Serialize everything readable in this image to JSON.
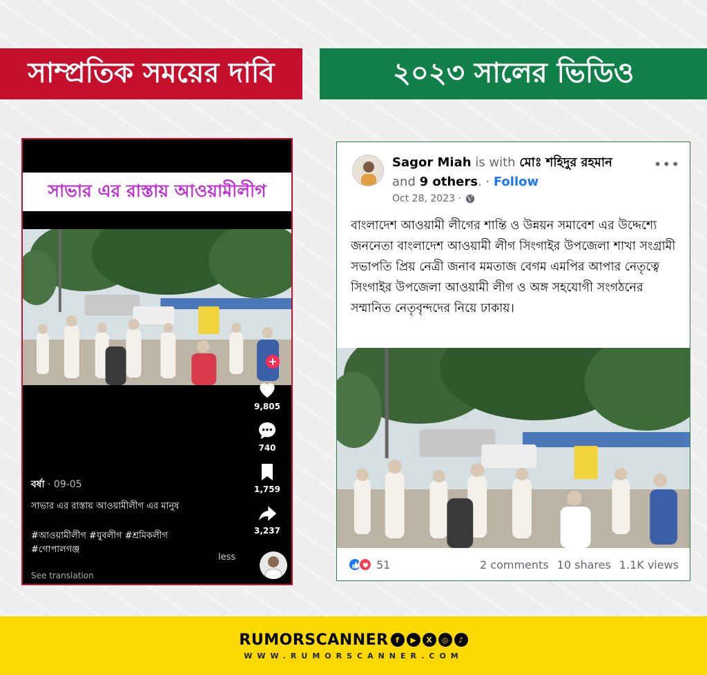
{
  "banners": {
    "left": "সাম্প্রতিক সময়ের দাবি",
    "right": "২০২৩ সালের ভিডিও"
  },
  "tiktok": {
    "caption": "সাভার এর রাস্তায় আওয়ামীলীগ",
    "username": "বর্ষা",
    "date": " · 09-05",
    "description": "সাভার এর রাস্তায় আওয়ামীলীগ এর মানুষ",
    "tags_line1": "#আওয়ামীলীগ #যুবলীগ #শ্রমিকলীগ",
    "tags_line2": "#গোপালগঞ্জ",
    "less_label": "less",
    "translate_label": "See translation",
    "plus_label": "+",
    "likes": "9,805",
    "comments": "740",
    "saves": "1,759",
    "shares": "3,237"
  },
  "facebook": {
    "author": "Sagor Miah",
    "is_with": " is with ",
    "tagged": "মোঃ শহিদুর রহমান",
    "and_text": "and ",
    "others": "9 others",
    "separator": ". · ",
    "follow_label": "Follow",
    "date": "Oct 28, 2023 ·",
    "menu_label": "•••",
    "post_text": "বাংলাদেশ আওয়ামী লীগের শান্তি ও উন্নয়ন সমাবেশ এর উদ্দেশ্যে জননেতা  বাংলাদেশ আওয়ামী লীগ সিংগাইর উপজেলা শাখা সংগ্রামী সভাপতি প্রিয় নেত্রী জনাব মমতাজ বেগম এমপির আপার নেতৃত্বে সিংগাইর উপজেলা আওয়ামী লীগ ও অঙ্গ সহযোগী সংগঠনের সম্মানিত নেতৃবৃন্দদের নিয়ে ঢাকায়।",
    "reaction_count": "51",
    "comments_label": "2 comments",
    "shares_label": "10 shares",
    "views_label": "1.1K views"
  },
  "footer": {
    "brand": "RUMORSCANNER",
    "url": "WWW.RUMORSCANNER.COM",
    "social_icons": [
      "facebook-icon",
      "youtube-icon",
      "x-icon",
      "instagram-icon",
      "tiktok-icon"
    ]
  },
  "colors": {
    "claim_red": "#c5102e",
    "fact_green": "#128049",
    "footer_yellow": "#fbd800",
    "tiktok_pink": "#c02dd6",
    "fb_blue": "#1877f2"
  }
}
